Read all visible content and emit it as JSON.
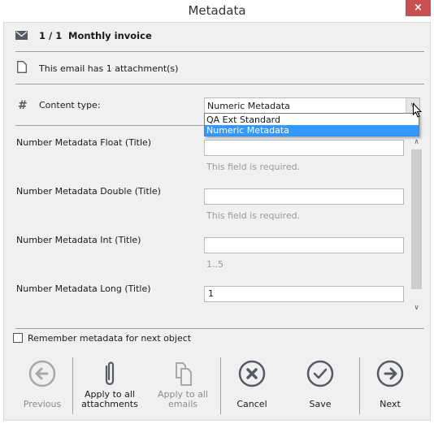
{
  "window": {
    "title": "Metadata",
    "close_label": "×"
  },
  "header": {
    "counter": "1 / 1",
    "subject": "Monthly invoice"
  },
  "attachment_info": "This email has 1 attachment(s)",
  "content_type": {
    "label": "Content type:",
    "selected": "Numeric Metadata",
    "options": [
      "QA Ext Standard",
      "Numeric Metadata"
    ],
    "highlighted_index": 1
  },
  "fields": [
    {
      "label": "Number Metadata Float (Title)",
      "value": "",
      "hint": "This field is required."
    },
    {
      "label": "Number Metadata Double (Title)",
      "value": "",
      "hint": "This field is required."
    },
    {
      "label": "Number Metadata Int (Title)",
      "value": "",
      "hint": "1..5"
    },
    {
      "label": "Number Metadata Long (Title)",
      "value": "1",
      "hint": ""
    }
  ],
  "remember": {
    "label": "Remember metadata for next object",
    "checked": false
  },
  "actions": [
    {
      "id": "previous",
      "label_line1": "",
      "label_line2": "Previous",
      "enabled": false,
      "icon": "arrow-left-circle-icon"
    },
    {
      "id": "apply-attachments",
      "label_line1": "Apply to all",
      "label_line2": "attachments",
      "enabled": true,
      "icon": "paperclip-icon"
    },
    {
      "id": "apply-emails",
      "label_line1": "Apply to all",
      "label_line2": "emails",
      "enabled": false,
      "icon": "copy-documents-icon"
    },
    {
      "id": "cancel",
      "label_line1": "",
      "label_line2": "Cancel",
      "enabled": true,
      "icon": "x-circle-icon"
    },
    {
      "id": "save",
      "label_line1": "",
      "label_line2": "Save",
      "enabled": true,
      "icon": "check-circle-icon"
    },
    {
      "id": "next",
      "label_line1": "",
      "label_line2": "Next",
      "enabled": true,
      "icon": "arrow-right-circle-icon"
    }
  ],
  "colors": {
    "accent": "#3399ff",
    "close": "#c75050",
    "icon": "#555a66",
    "disabled": "#a0a0a0"
  }
}
